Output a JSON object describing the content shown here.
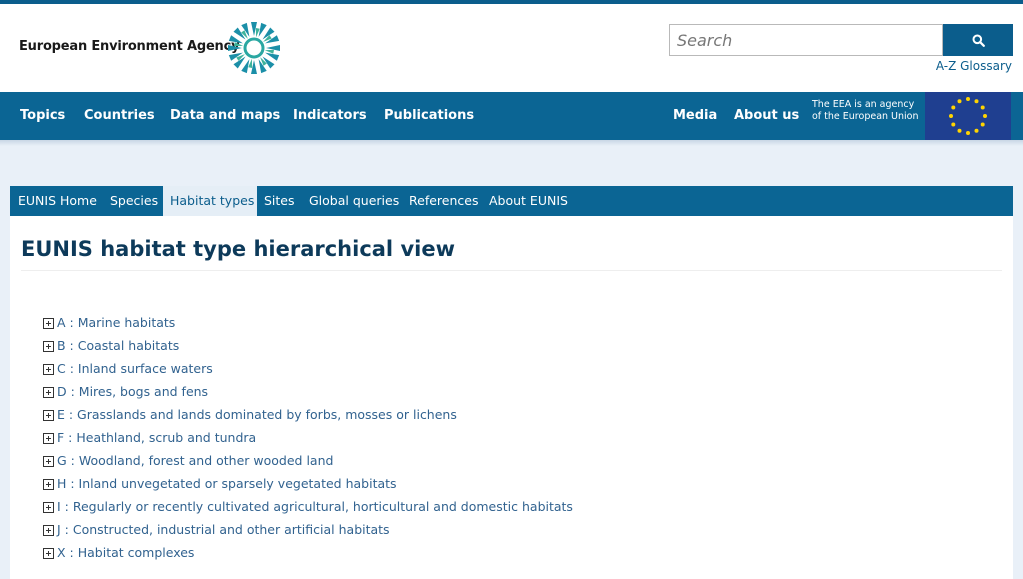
{
  "header": {
    "logo_text": "European Environment Agency",
    "search_placeholder": "Search",
    "search_icon": "search-icon",
    "glossary_link": "A-Z Glossary"
  },
  "main_nav": {
    "left_items": [
      "Topics",
      "Countries",
      "Data and maps",
      "Indicators",
      "Publications"
    ],
    "right_items": [
      "Media",
      "About us"
    ],
    "agency_note": "The EEA is an agency of the European Union",
    "flag_icon": "eu-flag-icon"
  },
  "sub_nav": {
    "items": [
      "EUNIS Home",
      "Species",
      "Habitat types",
      "Sites",
      "Global queries",
      "References",
      "About EUNIS"
    ],
    "active": "Habitat types"
  },
  "page": {
    "title": "EUNIS habitat type hierarchical view"
  },
  "tree": {
    "items": [
      "A : Marine habitats",
      "B : Coastal habitats",
      "C : Inland surface waters",
      "D : Mires, bogs and fens",
      "E : Grasslands and lands dominated by forbs, mosses or lichens",
      "F : Heathland, scrub and tundra",
      "G : Woodland, forest and other wooded land",
      "H : Inland unvegetated or sparsely vegetated habitats",
      "I : Regularly or recently cultivated agricultural, horticultural and domestic habitats",
      "J : Constructed, industrial and other artificial habitats",
      "X : Habitat complexes"
    ],
    "expand_icon": "plus-box-icon"
  },
  "colors": {
    "brand_blue": "#0b6594",
    "title_color": "#0d3a5a",
    "link_color": "#31628f",
    "page_bg": "#e9f0f8"
  }
}
